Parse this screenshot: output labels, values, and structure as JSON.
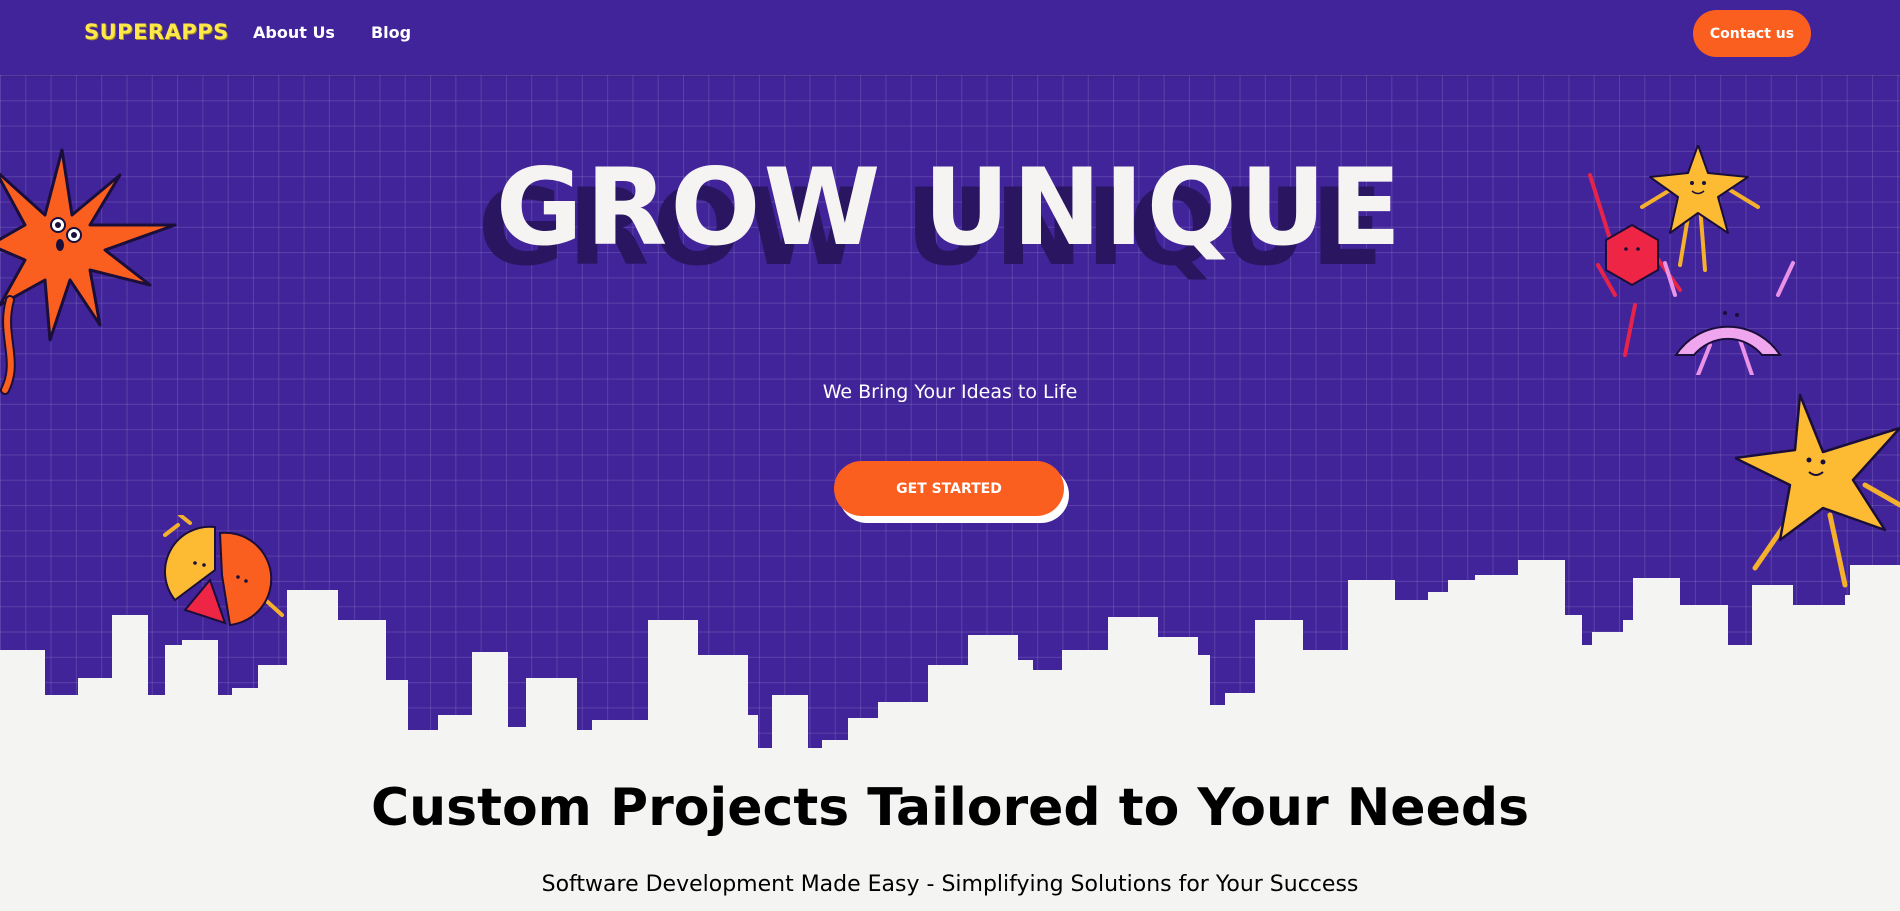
{
  "header": {
    "logo": "SUPERAPPS",
    "nav": [
      {
        "label": "About Us"
      },
      {
        "label": "Blog"
      }
    ],
    "contact_label": "Contact us"
  },
  "hero": {
    "title": "GROW UNIQUE",
    "subtitle": "We Bring Your Ideas to Life",
    "cta_label": "GET STARTED"
  },
  "section": {
    "title": "Custom Projects Tailored to Your Needs",
    "subtitle": "Software Development Made Easy -  Simplifying Solutions for Your Success"
  },
  "colors": {
    "brand_purple": "#42249a",
    "accent_orange": "#fb5f20",
    "logo_yellow": "#fde84a",
    "page_white": "#f4f4f3"
  },
  "illustrations": [
    "orange-spiky-sun-character",
    "yellow-star-character",
    "red-hexagon-character",
    "pink-arc-character",
    "large-yellow-star-character",
    "pie-chart-character",
    "city-skyline"
  ]
}
